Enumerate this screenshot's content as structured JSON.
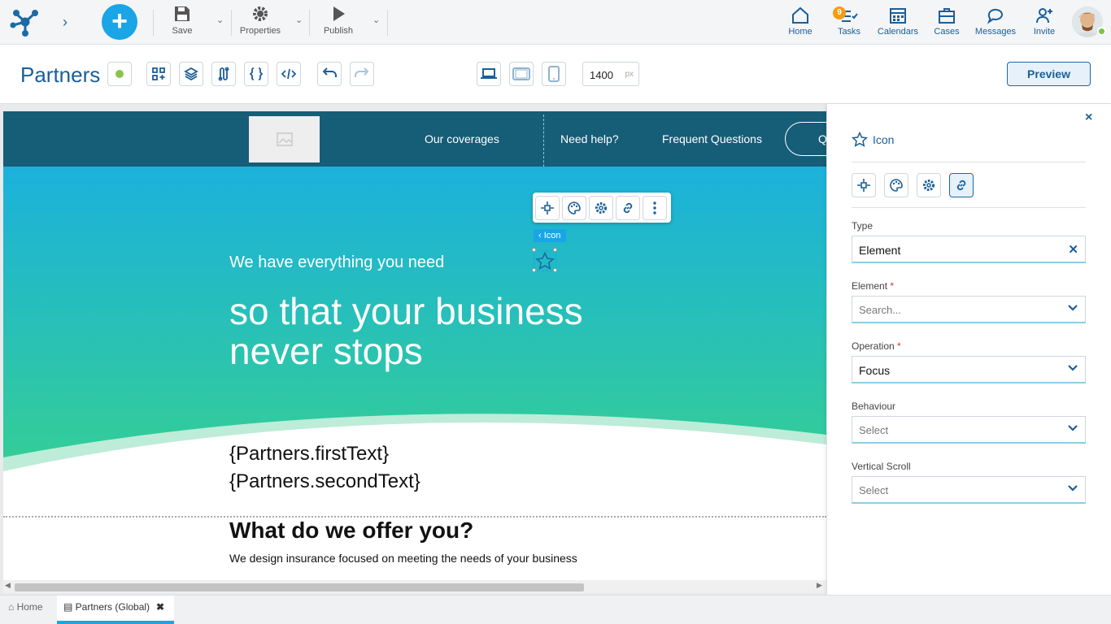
{
  "toolbar": {
    "save": "Save",
    "properties": "Properties",
    "publish": "Publish"
  },
  "right_nav": {
    "home": "Home",
    "tasks": "Tasks",
    "tasks_badge": "9",
    "calendars": "Calendars",
    "cases": "Cases",
    "messages": "Messages",
    "invite": "Invite"
  },
  "editor": {
    "title": "Partners",
    "width_value": "1400",
    "width_unit": "px",
    "preview": "Preview"
  },
  "site": {
    "nav": [
      "Our coverages",
      "Need help?",
      "Frequent Questions"
    ],
    "nav_button": "Q",
    "hero_small": "We have everything you need",
    "hero_big_1": "so that your business",
    "hero_big_2": "never stops",
    "text_1": "{Partners.firstText}",
    "text_2": "{Partners.secondText}",
    "heading": "What do we offer you?",
    "paragraph": "We design insurance focused on meeting the needs of your business"
  },
  "selection": {
    "tag": "Icon"
  },
  "panel": {
    "title": "Icon",
    "type_label": "Type",
    "type_value": "Element",
    "element_label": "Element",
    "element_placeholder": "Search...",
    "operation_label": "Operation",
    "operation_value": "Focus",
    "behaviour_label": "Behaviour",
    "behaviour_value": "Select",
    "vscroll_label": "Vertical Scroll",
    "vscroll_value": "Select",
    "required_mark": "*"
  },
  "tabs": {
    "home": "Home",
    "partners": "Partners (Global)"
  },
  "colors": {
    "accent": "#1aa5e6",
    "brand": "#1a5f99",
    "nav_bg": "#165d77",
    "hero_top": "#1bb1dc",
    "hero_bottom": "#33cd98"
  }
}
